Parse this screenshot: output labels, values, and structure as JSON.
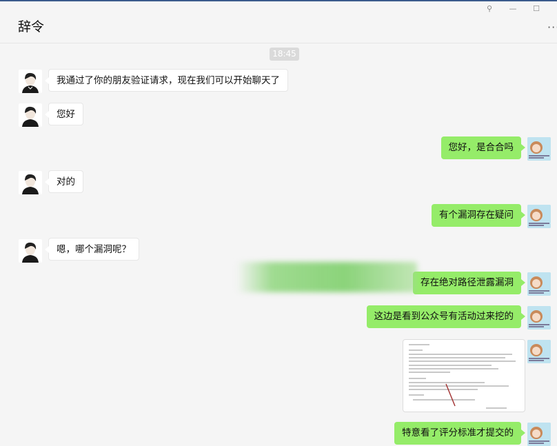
{
  "window": {
    "title": "辞令",
    "controls": {
      "pin": "⚲",
      "minimize": "—",
      "maximize": "☐",
      "more": "···"
    }
  },
  "chat": {
    "timestamp": "18:45",
    "messages": [
      {
        "side": "left",
        "text": "我通过了你的朋友验证请求，现在我们可以开始聊天了"
      },
      {
        "side": "left",
        "text": "您好"
      },
      {
        "side": "right",
        "text": "您好，是合合吗"
      },
      {
        "side": "left",
        "text": "对的"
      },
      {
        "side": "right",
        "text": "有个漏洞存在疑问"
      },
      {
        "side": "left",
        "text": "嗯，哪个漏洞呢？"
      },
      {
        "side": "right",
        "text": "存在绝对路径泄露漏洞"
      },
      {
        "side": "right",
        "text": "这边是看到公众号有活动过来挖的"
      },
      {
        "side": "right",
        "type": "image"
      },
      {
        "side": "right",
        "text": "特意看了评分标准才提交的"
      }
    ]
  },
  "colors": {
    "outgoing": "#95ec69",
    "incoming": "#ffffff",
    "background": "#f5f5f5"
  },
  "icons": {
    "contact_avatar": "boy-avatar-icon",
    "self_avatar": "anime-avatar-icon"
  }
}
